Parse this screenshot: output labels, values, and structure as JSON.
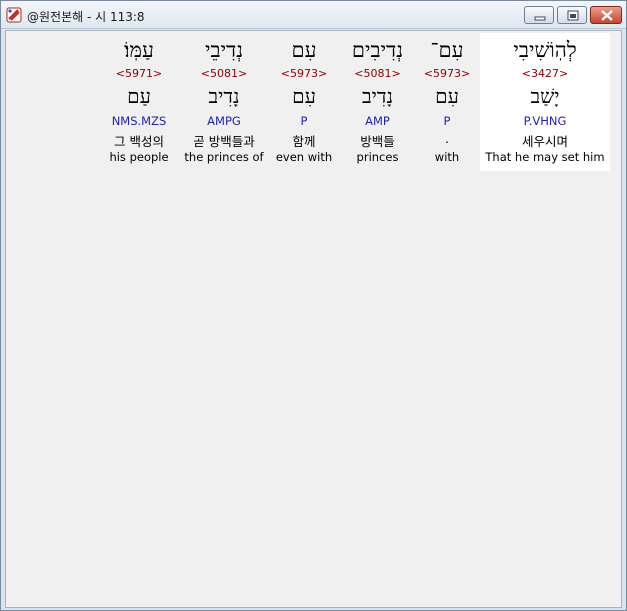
{
  "window": {
    "title": "@원전본해 - 시 113:8"
  },
  "words": [
    {
      "hebrew": "לְהֽוֹשִׁיבִי",
      "strong": "<3427>",
      "lemma": "יָשַׁב",
      "morph": "P.VHNG",
      "korean": "세우시며",
      "english": "That he may set him",
      "selected": true
    },
    {
      "hebrew": "עִם־",
      "strong": "<5973>",
      "lemma": "עִם",
      "morph": "P",
      "korean": ".",
      "english": "with",
      "selected": false
    },
    {
      "hebrew": "נְדִיבִים",
      "strong": "<5081>",
      "lemma": "נָדִיב",
      "morph": "AMP",
      "korean": "방백들",
      "english": "princes",
      "selected": false
    },
    {
      "hebrew": "עִם",
      "strong": "<5973>",
      "lemma": "עִם",
      "morph": "P",
      "korean": "함께",
      "english": "even with",
      "selected": false
    },
    {
      "hebrew": "נְדִיבֵי",
      "strong": "<5081>",
      "lemma": "נָדִיב",
      "morph": "AMPG",
      "korean": "곧 방백들과",
      "english": "the princes of",
      "selected": false
    },
    {
      "hebrew": "עַמּֽוֹ׃",
      "strong": "<5971>",
      "lemma": "עַם",
      "morph": "NMS.MZS",
      "korean": "그 백성의",
      "english": "his people",
      "selected": false
    }
  ]
}
